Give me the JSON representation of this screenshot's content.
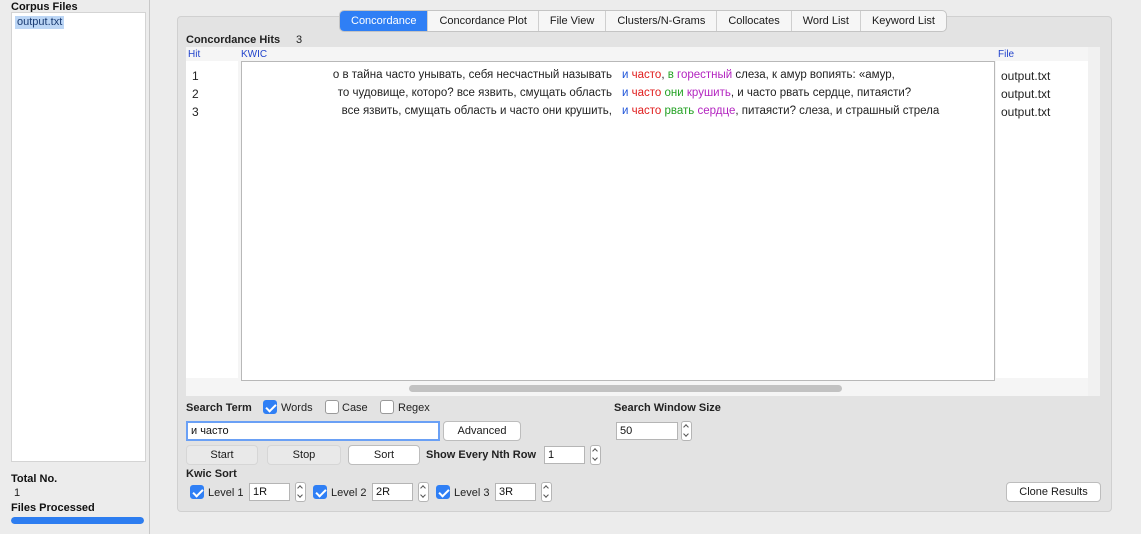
{
  "sidebar": {
    "corpus_files_label": "Corpus Files",
    "files": [
      "output.txt"
    ],
    "total_no_label": "Total No.",
    "total_no_value": "1",
    "files_processed_label": "Files Processed",
    "progress_fraction": 1.0
  },
  "tabs": [
    {
      "label": "Concordance",
      "active": true
    },
    {
      "label": "Concordance Plot",
      "active": false
    },
    {
      "label": "File View",
      "active": false
    },
    {
      "label": "Clusters/N-Grams",
      "active": false
    },
    {
      "label": "Collocates",
      "active": false
    },
    {
      "label": "Word List",
      "active": false
    },
    {
      "label": "Keyword List",
      "active": false
    }
  ],
  "concordance": {
    "hits_label": "Concordance Hits",
    "hits_count": "3",
    "columns": {
      "hit": "Hit",
      "kwic": "KWIC",
      "file": "File"
    },
    "rows": [
      {
        "hit": "1",
        "left": "о в тайна часто унывать, себя несчастный называть",
        "node_1": "и",
        "node_2": "часто",
        "sep": ", ",
        "r1": "в",
        "r1_sep": " ",
        "r2": "горестный",
        "rest": " слеза, к амур вопиять: «амур,",
        "file": "output.txt"
      },
      {
        "hit": "2",
        "left": "то чудовище, которо? все язвить, смущать область",
        "node_1": "и",
        "node_2": "часто",
        "sep": " ",
        "r1": "они",
        "r1_sep": " ",
        "r2": "крушить",
        "rest": ", и часто рвать сердце, питаясти?",
        "file": "output.txt"
      },
      {
        "hit": "3",
        "left": "все язвить, смущать область и часто они крушить,",
        "node_1": "и",
        "node_2": "часто",
        "sep": " ",
        "r1": "рвать",
        "r1_sep": " ",
        "r2": "сердце",
        "rest": ", питаясти? слеза, и страшный стрела",
        "file": "output.txt"
      }
    ]
  },
  "search": {
    "search_term_label": "Search Term",
    "words_label": "Words",
    "words_checked": true,
    "case_label": "Case",
    "case_checked": false,
    "regex_label": "Regex",
    "regex_checked": false,
    "query": "и часто",
    "advanced_label": "Advanced",
    "window_size_label": "Search Window Size",
    "window_size": "50",
    "start_label": "Start",
    "stop_label": "Stop",
    "sort_label": "Sort",
    "nth_row_label": "Show Every Nth Row",
    "nth_row_value": "1"
  },
  "kwic_sort": {
    "label": "Kwic Sort",
    "levels": [
      {
        "label": "Level 1",
        "value": "1R",
        "checked": true
      },
      {
        "label": "Level 2",
        "value": "2R",
        "checked": true
      },
      {
        "label": "Level 3",
        "value": "3R",
        "checked": true
      }
    ],
    "clone_label": "Clone Results"
  },
  "colors": {
    "accent": "#2f7ff5",
    "node_1": "#1f55d9",
    "node_2": "#e01e1e",
    "r1": "#24a224",
    "r2": "#b324c0"
  }
}
